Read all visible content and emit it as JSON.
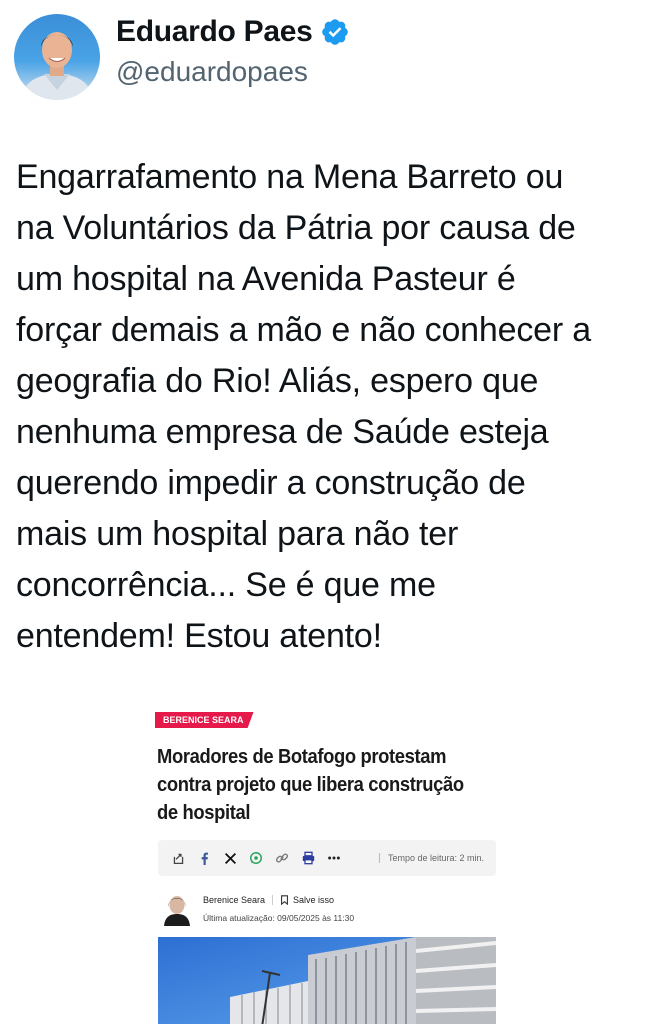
{
  "profile": {
    "name": "Eduardo Paes",
    "handle": "@eduardopaes",
    "verified": true,
    "verified_color": "#1d9bf0"
  },
  "tweet": {
    "text": "Engarrafamento na Mena Barreto ou\nna Voluntários da Pátria por causa de\num hospital na Avenida Pasteur é\nforçar demais a mão e não conhecer a\ngeografia do Rio!  Aliás, espero que\nnenhuma empresa de Saúde esteja\nquerendo impedir a construção de\nmais um hospital para não ter\nconcorrência...  Se é que me\nentendem!  Estou atento!"
  },
  "article": {
    "tag": "BERENICE SEARA",
    "tag_color": "#e5194a",
    "headline": "Moradores de Botafogo protestam contra projeto que libera construção de hospital",
    "share_icons": [
      "share-icon",
      "facebook-icon",
      "x-icon",
      "whatsapp-icon",
      "link-icon",
      "print-icon",
      "more-icon"
    ],
    "reading_time": "Tempo de leitura: 2 min.",
    "author": "Berenice Seara",
    "save_label": "Salve isso",
    "updated": "Última atualização: 09/05/2025 às 11:30"
  }
}
